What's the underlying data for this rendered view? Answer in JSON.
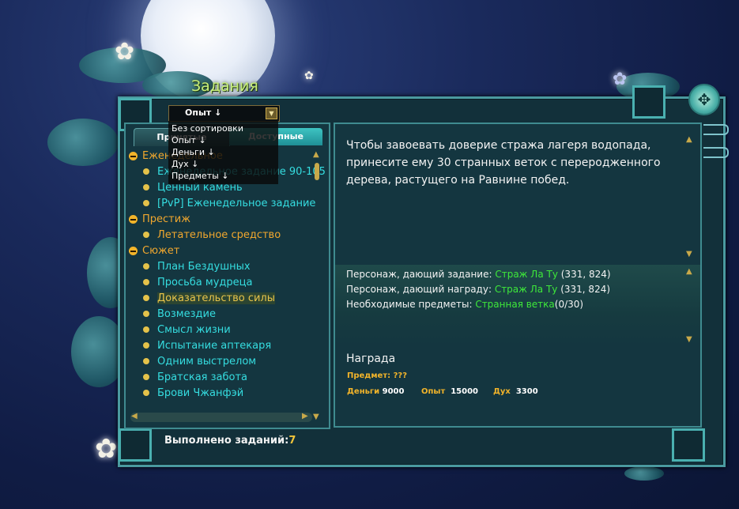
{
  "window": {
    "title": "Задания",
    "sort_selected": "Опыт",
    "sort_arrow": "↓"
  },
  "sort_menu": [
    {
      "label": "Без сортировки",
      "arrow": ""
    },
    {
      "label": "Опыт",
      "arrow": "↓"
    },
    {
      "label": "Деньги",
      "arrow": "↓"
    },
    {
      "label": "Дух",
      "arrow": "↓"
    },
    {
      "label": "Предметы",
      "arrow": "↓"
    }
  ],
  "tabs": [
    {
      "label": "Принятые"
    },
    {
      "label": "Доступные"
    }
  ],
  "quest_tree": [
    {
      "label": "Еженедельное",
      "type": "category"
    },
    {
      "label": "Еженедельное задание 90-105",
      "type": "quest",
      "color": "cyan"
    },
    {
      "label": "Ценный камень",
      "type": "quest",
      "color": "cyan"
    },
    {
      "label": "[PvP] Еженедельное задание",
      "type": "quest",
      "color": "cyan"
    },
    {
      "label": "Престиж",
      "type": "category"
    },
    {
      "label": "Летательное средство",
      "type": "quest",
      "color": "orange"
    },
    {
      "label": "Сюжет",
      "type": "category"
    },
    {
      "label": "План Бездушных",
      "type": "quest",
      "color": "cyan"
    },
    {
      "label": "Просьба мудреца",
      "type": "quest",
      "color": "cyan"
    },
    {
      "label": "Доказательство силы",
      "type": "quest",
      "color": "selected"
    },
    {
      "label": "Возмездие",
      "type": "quest",
      "color": "cyan"
    },
    {
      "label": "Смысл жизни",
      "type": "quest",
      "color": "cyan"
    },
    {
      "label": "Испытание аптекаря",
      "type": "quest",
      "color": "cyan"
    },
    {
      "label": "Одним выстрелом",
      "type": "quest",
      "color": "cyan"
    },
    {
      "label": "Братская забота",
      "type": "quest",
      "color": "cyan"
    },
    {
      "label": "Брови Чжанфэй",
      "type": "quest",
      "color": "cyan"
    }
  ],
  "details": {
    "description": "Чтобы завоевать доверие стража лагеря водопада, принесите ему 30 странных веток с переродженного дерева, растущего на Равнине побед.",
    "giver_label": "Персонаж, дающий задание: ",
    "giver_name": "Страж Ла Ту",
    "giver_coords": " (331, 824)",
    "rewarder_label": "Персонаж, дающий награду: ",
    "rewarder_name": "Страж Ла Ту",
    "rewarder_coords": " (331, 824)",
    "items_label": "Необходимые предметы: ",
    "items_name": "Странная ветка",
    "items_count": "(0/30)"
  },
  "reward": {
    "heading": "Награда",
    "item_label": "Предмет:",
    "item_value": "???",
    "money_label": "Деньги",
    "money_value": "9000",
    "exp_label": "Опыт",
    "exp_value": "15000",
    "spirit_label": "Дух",
    "spirit_value": "3300"
  },
  "footer": {
    "completed_label": "Выполнено заданий:",
    "completed_value": "7"
  },
  "colors": {
    "quest_cyan": "#35dde0",
    "category_orange": "#f0a72e",
    "npc_green": "#3ee83a",
    "title_green": "#c8f07a"
  }
}
